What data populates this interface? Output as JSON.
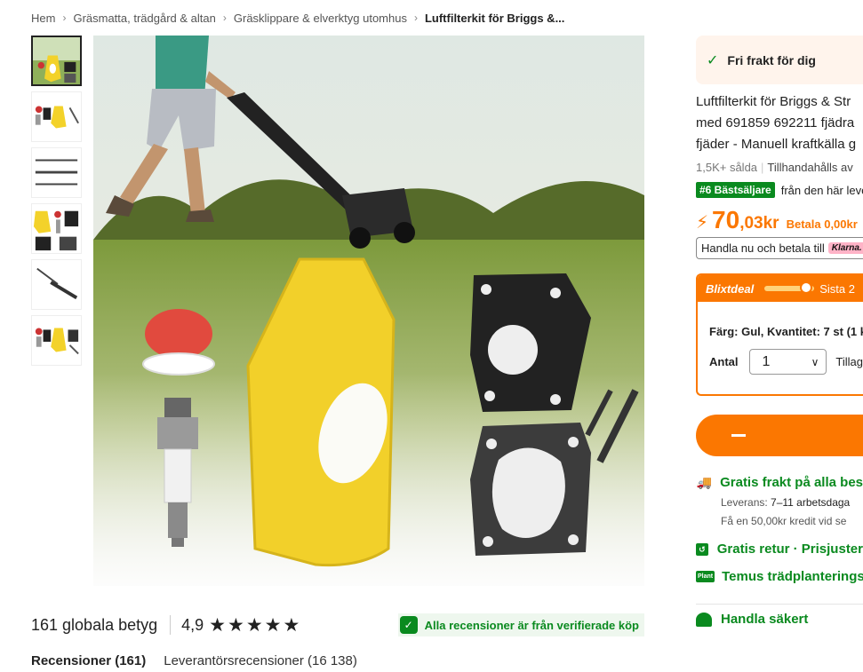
{
  "breadcrumb": {
    "items": [
      "Hem",
      "Gräsmatta, trädgård & altan",
      "Gräsklippare & elverktyg utomhus"
    ],
    "current": "Luftfilterkit för Briggs &..."
  },
  "thumbnails": [
    "product-thumb-1",
    "product-thumb-2",
    "product-thumb-3",
    "product-thumb-4",
    "product-thumb-5",
    "product-thumb-6"
  ],
  "reviews": {
    "count_label": "161 globala betyg",
    "score": "4,9",
    "stars": [
      "★",
      "★",
      "★",
      "★",
      "★"
    ],
    "verified": "Alla recensioner är från verifierade köp",
    "tabs": [
      "Recensioner (161)",
      "Leverantörsrecensioner (16 138)"
    ]
  },
  "sidebar": {
    "free_shipping": "Fri frakt för dig",
    "title_lines": [
      "Luftfilterkit för Briggs & Str",
      "med 691859 692211 fjädra",
      "fjäder - Manuell kraftkälla g"
    ],
    "sold": "1,5K+ sålda",
    "supply": "Tillhandahålls av",
    "bestseller_badge": "#6 Bästsäljare",
    "bestseller_text": "från den här leve",
    "price_int": "70",
    "price_dec": ",03kr",
    "pay_later": "Betala 0,00kr",
    "klarna_text": "Handla nu och betala till",
    "klarna_logo": "Klarna.",
    "deal_title": "Blixtdeal",
    "deal_text": "Sista 2",
    "deal_progress": 0.85,
    "variant": "Färg: Gul, Kvantitet: 7 st (1 k",
    "qty_label": "Antal",
    "qty_value": "1",
    "qty_extra": "Tillag",
    "ship_title": "Gratis frakt på alla bes",
    "delivery_label": "Leverans:",
    "delivery_value": "7–11 arbetsdaga",
    "credit": "Få en 50,00kr kredit vid se",
    "returns": "Gratis retur · Prisjuster",
    "plant_badge": "Plant",
    "plant": "Temus trädplanterings",
    "bottom": "Handla säkert"
  },
  "colors": {
    "accent": "#fb7701",
    "green": "#0a8a1f"
  }
}
